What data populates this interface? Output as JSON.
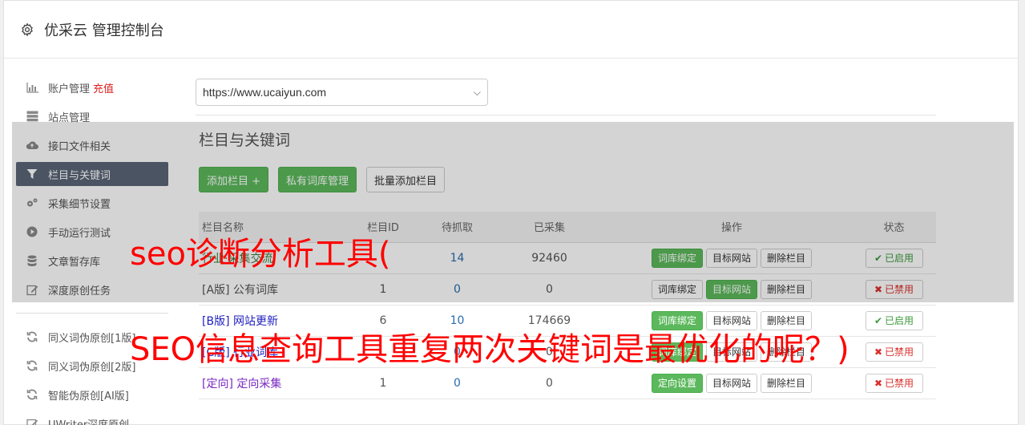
{
  "header": {
    "title": "优采云 管理控制台"
  },
  "sidebar": {
    "items": [
      {
        "label": "账户管理",
        "extra": "充值",
        "icon": "bar-chart-icon"
      },
      {
        "label": "站点管理",
        "icon": "server-icon"
      },
      {
        "label": "接口文件相关",
        "icon": "cloud-upload-icon"
      },
      {
        "label": "栏目与关键词",
        "icon": "filter-icon",
        "active": true
      },
      {
        "label": "采集细节设置",
        "icon": "cogs-icon"
      },
      {
        "label": "手动运行测试",
        "icon": "play-circle-icon"
      },
      {
        "label": "文章暂存库",
        "icon": "database-icon"
      },
      {
        "label": "深度原创任务",
        "icon": "edit-icon"
      }
    ],
    "items2": [
      {
        "label": "同义词伪原创[1版]",
        "icon": "refresh-icon"
      },
      {
        "label": "同义词伪原创[2版]",
        "icon": "refresh-icon"
      },
      {
        "label": "智能伪原创[AI版]",
        "icon": "refresh-icon"
      },
      {
        "label": "UWriter深度原创",
        "icon": "edit-icon"
      }
    ]
  },
  "site_select": {
    "value": "https://www.ucaiyun.com"
  },
  "main": {
    "section_title": "栏目与关键词",
    "buttons": {
      "add": "添加栏目 +",
      "private_lib": "私有词库管理",
      "batch_add": "批量添加栏目"
    }
  },
  "table": {
    "headers": [
      "栏目名称",
      "栏目ID",
      "待抓取",
      "已采集",
      "操作",
      "状态"
    ],
    "rows": [
      {
        "tag": "",
        "name": "行业·采集交流",
        "id": "",
        "pending": "14",
        "collected": "92460",
        "op1": "词库绑定",
        "op1_green": true,
        "op2": "目标网站",
        "op2_green": false,
        "op3": "删除栏目",
        "status": "已启用",
        "status_on": true
      },
      {
        "tag": "[A版]",
        "name": "公有词库",
        "id": "1",
        "pending": "0",
        "collected": "0",
        "op1": "词库绑定",
        "op1_green": false,
        "op2": "目标网站",
        "op2_green": true,
        "op3": "删除栏目",
        "status": "已禁用",
        "status_on": false
      },
      {
        "tag": "[B版]",
        "name": "网站更新",
        "id": "6",
        "pending": "10",
        "collected": "174669",
        "op1": "词库绑定",
        "op1_green": true,
        "op2": "目标网站",
        "op2_green": false,
        "op3": "删除栏目",
        "status": "已启用",
        "status_on": true
      },
      {
        "tag": "[C版]",
        "name": "行业词库",
        "id": "",
        "pending": "0",
        "collected": "0",
        "op1": "词库绑定",
        "op1_green": true,
        "op2": "目标网站",
        "op2_green": false,
        "op3": "删除栏目",
        "status": "已禁用",
        "status_on": false
      },
      {
        "tag": "[定向]",
        "name": "定向采集",
        "id": "1",
        "pending": "0",
        "collected": "0",
        "op1": "定向设置",
        "op1_green": true,
        "op2": "目标网站",
        "op2_green": false,
        "op3": "删除栏目",
        "status": "已禁用",
        "status_on": false
      }
    ]
  },
  "watermarks": {
    "line1": "seo诊断分析工具(",
    "line2": "SEO信息查询工具重复两次关键词是最优化的呢？)"
  },
  "colors": {
    "accent_green": "#5cb85c",
    "active_nav": "#5a6677",
    "watermark": "#ff0000"
  }
}
